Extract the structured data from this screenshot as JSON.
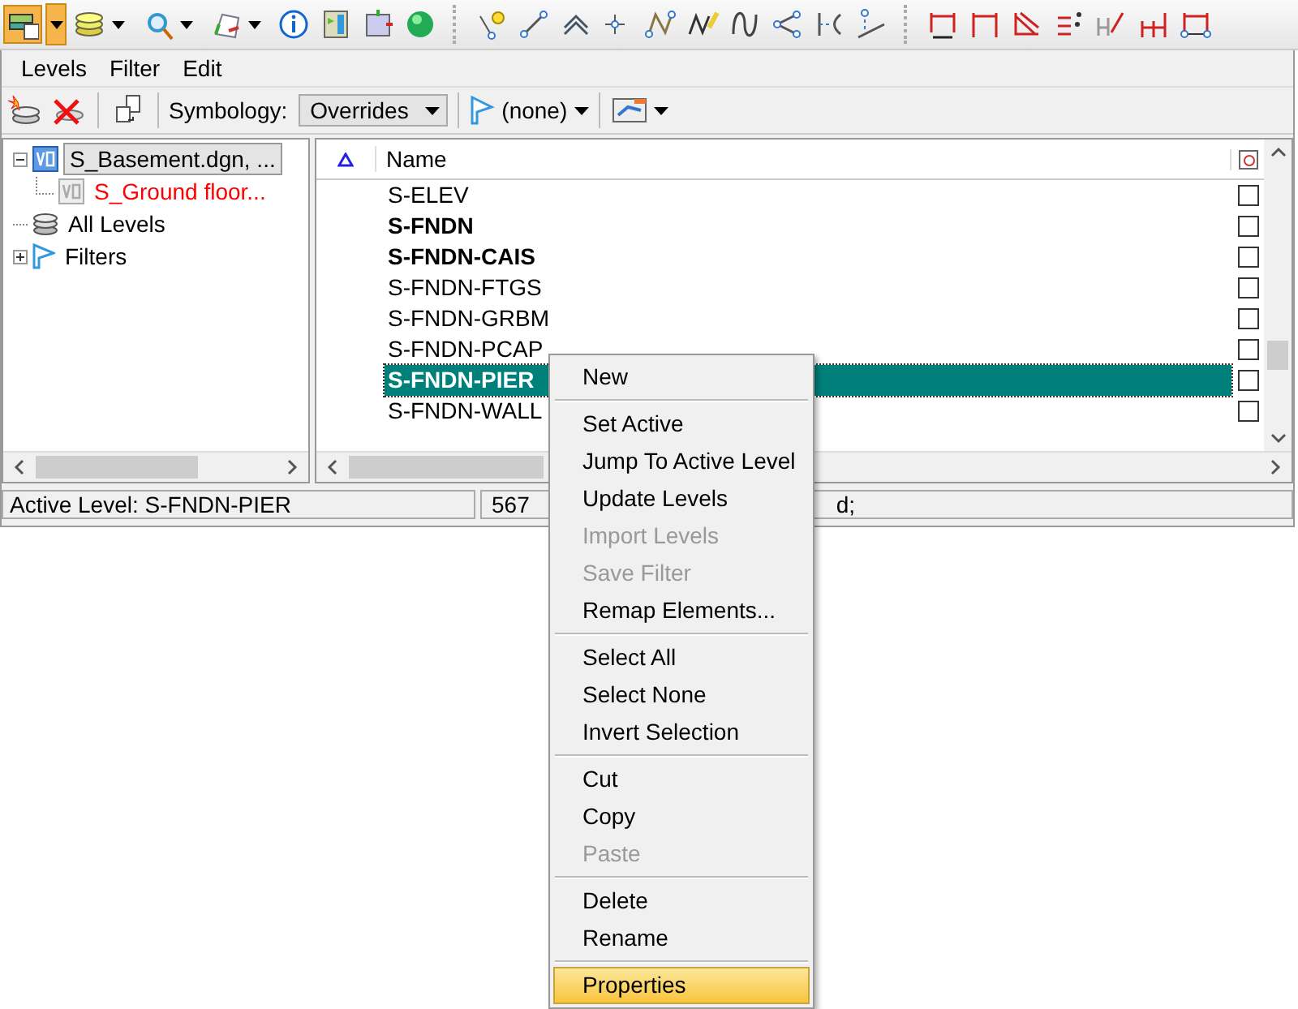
{
  "menu_bar": [
    {
      "label": "Levels"
    },
    {
      "label": "Filter"
    },
    {
      "label": "Edit"
    }
  ],
  "toolbar": {
    "symbology_label": "Symbology:",
    "symbology_value": "Overrides",
    "filter_value": "(none)"
  },
  "tree": [
    {
      "label": "S_Basement.dgn, ...",
      "selected": true,
      "expanded": true,
      "kind": "file",
      "children": [
        {
          "label": "S_Ground floor...",
          "selected": false
        }
      ]
    },
    {
      "label": "All Levels",
      "selected": false,
      "kind": "levels"
    },
    {
      "label": "Filters",
      "selected": false,
      "expanded": false,
      "kind": "filters"
    }
  ],
  "table": {
    "columns": [
      "Name"
    ],
    "rows": [
      {
        "name": "S-ELEV",
        "bold": false,
        "selected": false,
        "checked": false
      },
      {
        "name": "S-FNDN",
        "bold": true,
        "selected": false,
        "checked": false
      },
      {
        "name": "S-FNDN-CAIS",
        "bold": true,
        "selected": false,
        "checked": false
      },
      {
        "name": "S-FNDN-FTGS",
        "bold": false,
        "selected": false,
        "checked": false
      },
      {
        "name": "S-FNDN-GRBM",
        "bold": false,
        "selected": false,
        "checked": false
      },
      {
        "name": "S-FNDN-PCAP",
        "bold": false,
        "selected": false,
        "checked": false
      },
      {
        "name": "S-FNDN-PIER",
        "bold": true,
        "selected": true,
        "checked": false
      },
      {
        "name": "S-FNDN-WALL",
        "bold": false,
        "selected": false,
        "checked": false
      }
    ]
  },
  "status_bar": {
    "active_level": "Active Level: S-FNDN-PIER",
    "count_start": "567",
    "count_end": "d;"
  },
  "context_menu": [
    {
      "kind": "item",
      "label": "New",
      "disabled": false,
      "selected": false
    },
    {
      "kind": "separator"
    },
    {
      "kind": "item",
      "label": "Set Active",
      "disabled": false,
      "selected": false
    },
    {
      "kind": "item",
      "label": "Jump To Active Level",
      "disabled": false,
      "selected": false
    },
    {
      "kind": "item",
      "label": "Update Levels",
      "disabled": false,
      "selected": false
    },
    {
      "kind": "item",
      "label": "Import Levels",
      "disabled": true,
      "selected": false
    },
    {
      "kind": "item",
      "label": "Save Filter",
      "disabled": true,
      "selected": false
    },
    {
      "kind": "item",
      "label": "Remap Elements...",
      "disabled": false,
      "selected": false
    },
    {
      "kind": "separator"
    },
    {
      "kind": "item",
      "label": "Select All",
      "disabled": false,
      "selected": false
    },
    {
      "kind": "item",
      "label": "Select None",
      "disabled": false,
      "selected": false
    },
    {
      "kind": "item",
      "label": "Invert Selection",
      "disabled": false,
      "selected": false
    },
    {
      "kind": "separator"
    },
    {
      "kind": "item",
      "label": "Cut",
      "disabled": false,
      "selected": false
    },
    {
      "kind": "item",
      "label": "Copy",
      "disabled": false,
      "selected": false
    },
    {
      "kind": "item",
      "label": "Paste",
      "disabled": true,
      "selected": false
    },
    {
      "kind": "separator"
    },
    {
      "kind": "item",
      "label": "Delete",
      "disabled": false,
      "selected": false
    },
    {
      "kind": "item",
      "label": "Rename",
      "disabled": false,
      "selected": false
    },
    {
      "kind": "separator"
    },
    {
      "kind": "item",
      "label": "Properties",
      "disabled": false,
      "selected": true
    }
  ]
}
